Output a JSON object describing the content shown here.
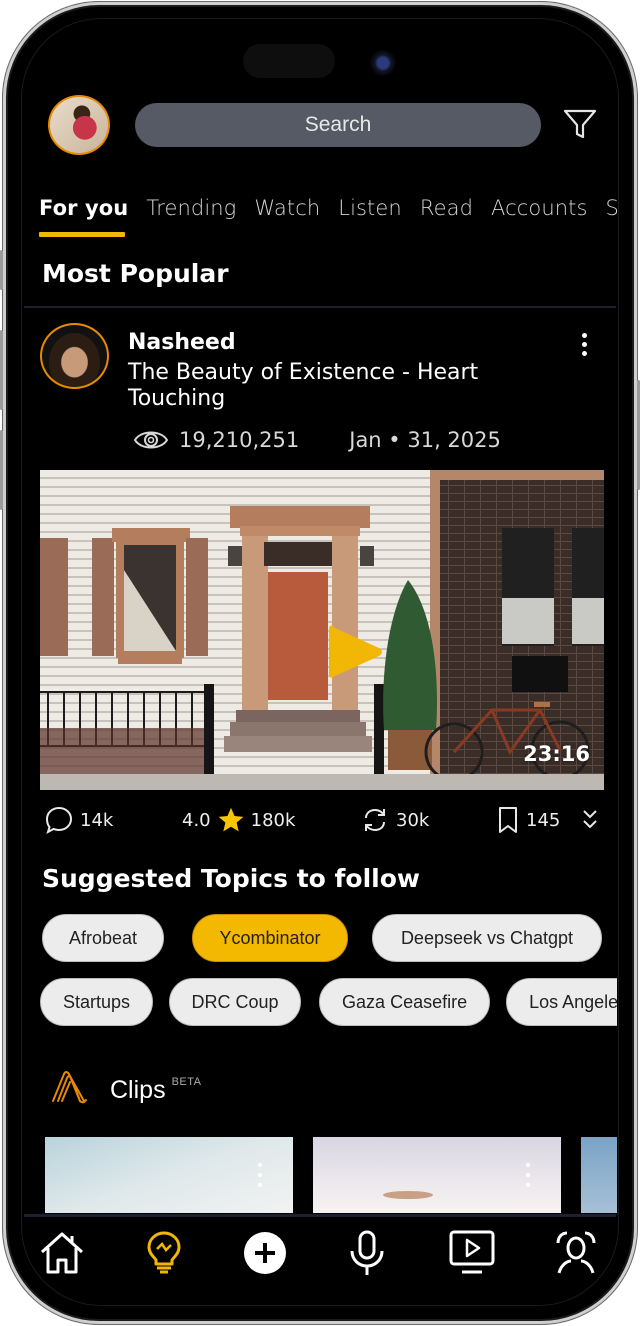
{
  "header": {
    "search_placeholder": "Search",
    "avatar_icon": "user-avatar",
    "filter_icon": "filter-icon"
  },
  "tabs": [
    {
      "label": "For you",
      "active": true
    },
    {
      "label": "Trending",
      "active": false
    },
    {
      "label": "Watch",
      "active": false
    },
    {
      "label": "Listen",
      "active": false
    },
    {
      "label": "Read",
      "active": false
    },
    {
      "label": "Accounts",
      "active": false
    },
    {
      "label": "S",
      "active": false
    }
  ],
  "most_popular": {
    "title": "Most Popular",
    "post": {
      "author": "Nasheed",
      "title": "The Beauty of Existence - Heart Touching",
      "views": "19,210,251",
      "date": "Jan • 31, 2025",
      "duration": "23:16",
      "stats": {
        "comments": "14k",
        "rating": "4.0",
        "ratings_count": "180k",
        "reposts": "30k",
        "bookmarks": "145"
      }
    }
  },
  "topics": {
    "title": "Suggested Topics to follow",
    "row1": [
      {
        "label": "Afrobeat",
        "selected": false
      },
      {
        "label": "Ycombinator",
        "selected": true
      },
      {
        "label": "Deepseek vs Chatgpt",
        "selected": false
      }
    ],
    "row2": [
      {
        "label": "Startups",
        "selected": false
      },
      {
        "label": "DRC Coup",
        "selected": false
      },
      {
        "label": "Gaza Ceasefire",
        "selected": false
      },
      {
        "label": "Los Angeles",
        "selected": false
      }
    ]
  },
  "clips": {
    "label": "Clips",
    "badge": "BETA"
  },
  "bottom_nav": [
    {
      "name": "home",
      "icon": "home-icon",
      "active": false
    },
    {
      "name": "ideas",
      "icon": "lightbulb-icon",
      "active": true
    },
    {
      "name": "create",
      "icon": "plus-circle-icon",
      "active": false
    },
    {
      "name": "audio",
      "icon": "microphone-icon",
      "active": false
    },
    {
      "name": "video",
      "icon": "tv-play-icon",
      "active": false
    },
    {
      "name": "profile",
      "icon": "face-scan-icon",
      "active": false
    }
  ],
  "colors": {
    "accent": "#f2b705",
    "avatar_ring": "#e88a00",
    "search_bg": "#555a64",
    "background": "#000000",
    "chip_bg": "#ececec"
  }
}
